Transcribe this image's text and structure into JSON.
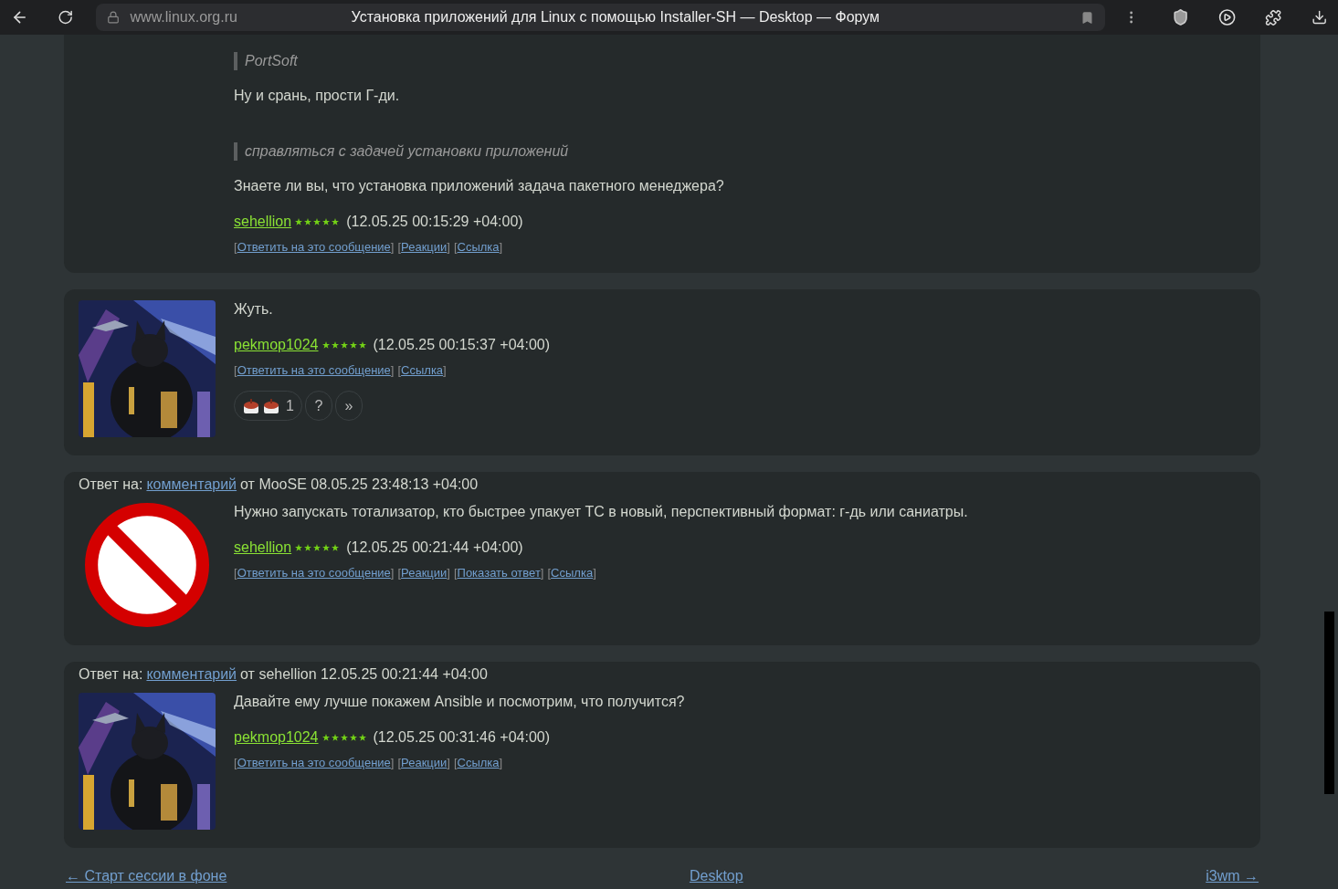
{
  "browser": {
    "url": "www.linux.org.ru",
    "title": "Установка приложений для Linux с помощью Installer-SH — Desktop — Форум"
  },
  "posts": [
    {
      "body": [
        {
          "kind": "quote",
          "text": "PortSoft"
        },
        {
          "kind": "para",
          "text": "Ну и срань, прости Г-ди."
        },
        {
          "kind": "quote",
          "text": "справляться с задачей установки приложений"
        },
        {
          "kind": "para",
          "text": "Знаете ли вы, что установка приложений задача пакетного менеджера?"
        }
      ],
      "author": "sehellion",
      "stars": 5,
      "date": "(12.05.25 00:15:29 +04:00)",
      "actions": [
        {
          "open": "[",
          "text": "Ответить на это сообщение",
          "close": "]"
        },
        {
          "open": "[",
          "text": "Реакции",
          "close": "]"
        },
        {
          "open": "[",
          "text": "Ссылка",
          "close": "]"
        }
      ]
    },
    {
      "avatar": {
        "kind": "picture"
      },
      "body": [
        {
          "kind": "para",
          "text": "Жуть."
        }
      ],
      "author": "pekmop1024",
      "stars": 5,
      "date": "(12.05.25 00:15:37 +04:00)",
      "actions": [
        {
          "open": "[",
          "text": "Ответить на это сообщение",
          "close": "]"
        },
        {
          "open": "[",
          "text": "Ссылка",
          "close": "]"
        }
      ],
      "reactions": [
        {
          "kind": "emoji",
          "count": "1"
        },
        {
          "kind": "text",
          "text": "?"
        },
        {
          "kind": "text",
          "text": "»"
        }
      ]
    },
    {
      "reply_to": {
        "label": "Ответ на:",
        "link": "комментарий",
        "rest": "от MooSE 08.05.25 23:48:13 +04:00"
      },
      "avatar": {
        "kind": "sign"
      },
      "body": [
        {
          "kind": "para",
          "text": "Нужно запускать тотализатор, кто быстрее упакует ТС в новый, перспективный формат: г-дь или саниатры."
        }
      ],
      "author": "sehellion",
      "stars": 5,
      "date": "(12.05.25 00:21:44 +04:00)",
      "actions": [
        {
          "open": "[",
          "text": "Ответить на это сообщение",
          "close": "]"
        },
        {
          "open": "[",
          "text": "Реакции",
          "close": "]"
        },
        {
          "open": "[",
          "text": "Показать ответ",
          "close": "]"
        },
        {
          "open": "[",
          "text": "Ссылка",
          "close": "]"
        }
      ]
    },
    {
      "reply_to": {
        "label": "Ответ на:",
        "link": "комментарий",
        "rest": "от sehellion 12.05.25 00:21:44 +04:00"
      },
      "avatar": {
        "kind": "picture"
      },
      "body": [
        {
          "kind": "para",
          "text": "Давайте ему лучше покажем Ansible и посмотрим, что получится?"
        }
      ],
      "author": "pekmop1024",
      "stars": 5,
      "date": "(12.05.25 00:31:46 +04:00)",
      "actions": [
        {
          "open": "[",
          "text": "Ответить на это сообщение",
          "close": "]"
        },
        {
          "open": "[",
          "text": "Реакции",
          "close": "]"
        },
        {
          "open": "[",
          "text": "Ссылка",
          "close": "]"
        }
      ]
    }
  ],
  "nav": {
    "prev": "← Старт сессии в фоне",
    "up": "Desktop",
    "next": "i3wm →"
  }
}
